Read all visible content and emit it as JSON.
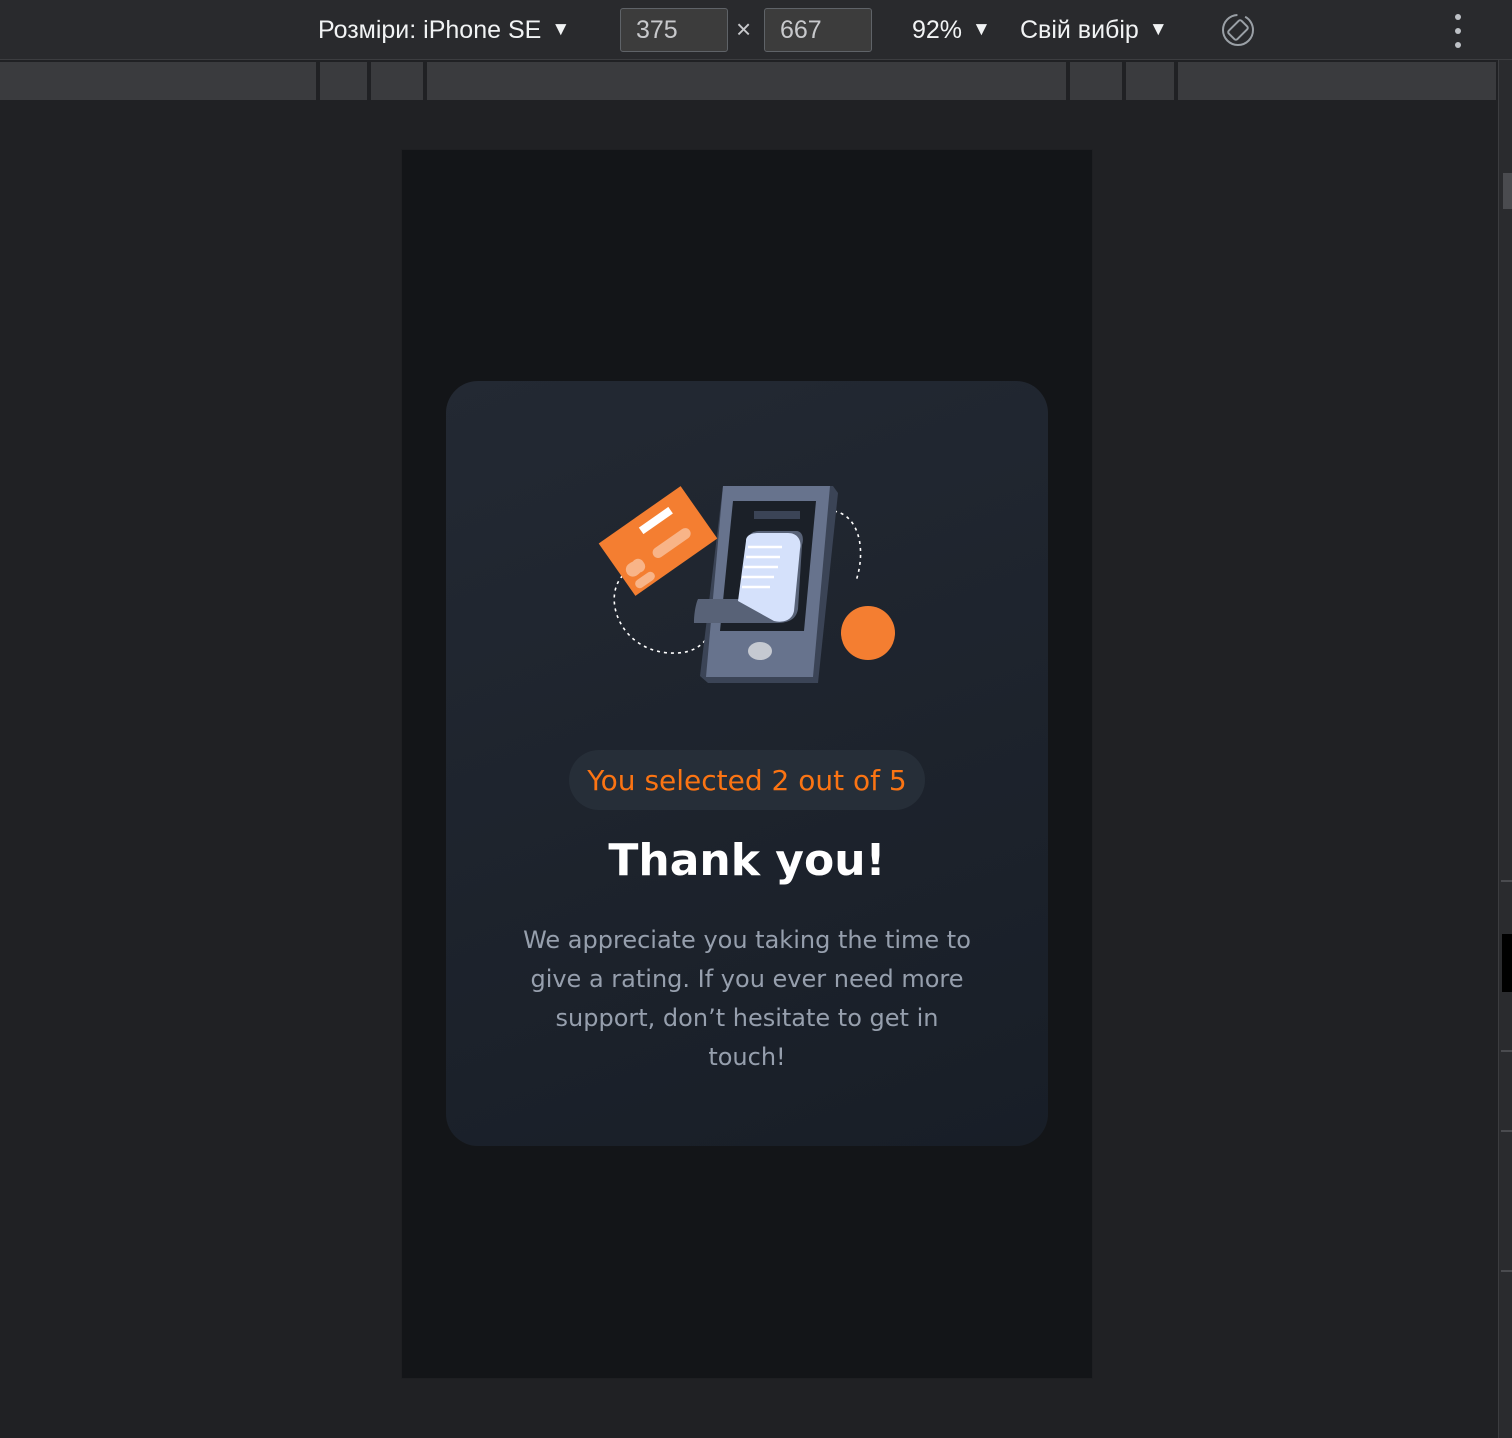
{
  "toolbar": {
    "device_label": "Розміри: iPhone SE",
    "width_value": "375",
    "times_symbol": "×",
    "height_value": "667",
    "zoom_label": "92%",
    "throttling_label": "Свій вибір",
    "dropdown_caret": "▼"
  },
  "card": {
    "badge_text": "You selected 2 out of 5",
    "title": "Thank you!",
    "message": "We appreciate you taking the time to give a rating. If you ever need more support, don’t hesitate to get in touch!"
  },
  "colors": {
    "accent": "#fb7413",
    "card_bg": "#1e252e",
    "page_bg": "#131518",
    "message_text": "#969fad"
  },
  "icons": [
    "rotate-icon",
    "more-vert-icon",
    "thank-you-illustration"
  ]
}
